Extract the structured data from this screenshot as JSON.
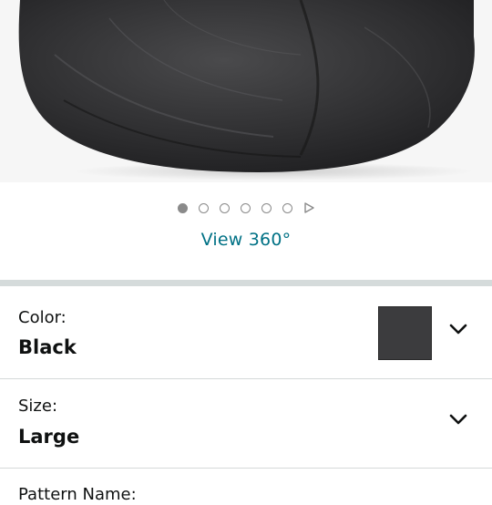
{
  "gallery": {
    "image_alt": "Black bean bag chair",
    "dot_count": 6,
    "active_index": 0,
    "view360_label": "View 360°"
  },
  "options": {
    "color": {
      "label": "Color:",
      "value": "Black",
      "swatch_color": "#3c3c3e"
    },
    "size": {
      "label": "Size:",
      "value": "Large"
    },
    "partial": {
      "label": "Pattern Name:"
    }
  },
  "colors": {
    "link": "#007185",
    "divider_band": "#d5dbdb"
  }
}
